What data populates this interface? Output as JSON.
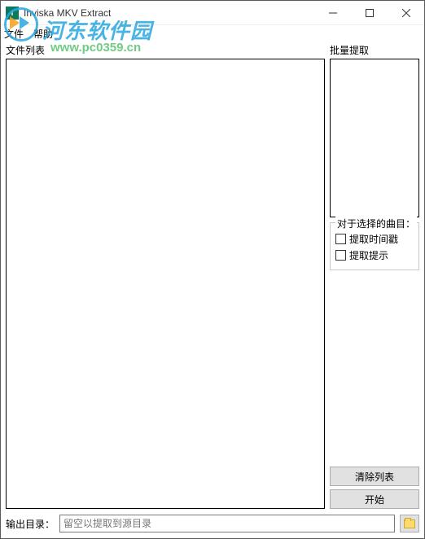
{
  "window": {
    "title": "Inviska MKV Extract",
    "app_icon_letter": "I"
  },
  "menu": {
    "file": "文件",
    "help": "帮助"
  },
  "labels": {
    "file_list": "文件列表",
    "batch_extract": "批量提取",
    "for_selected_tracks": "对于选择的曲目：",
    "output_dir": "输出目录："
  },
  "checkboxes": {
    "extract_timecodes": "提取时间戳",
    "extract_cues": "提取提示"
  },
  "buttons": {
    "clear_list": "清除列表",
    "start": "开始"
  },
  "output": {
    "placeholder": "留空以提取到源目录"
  },
  "watermark": {
    "site_name": "河东软件园",
    "site_url": "www.pc0359.cn"
  }
}
